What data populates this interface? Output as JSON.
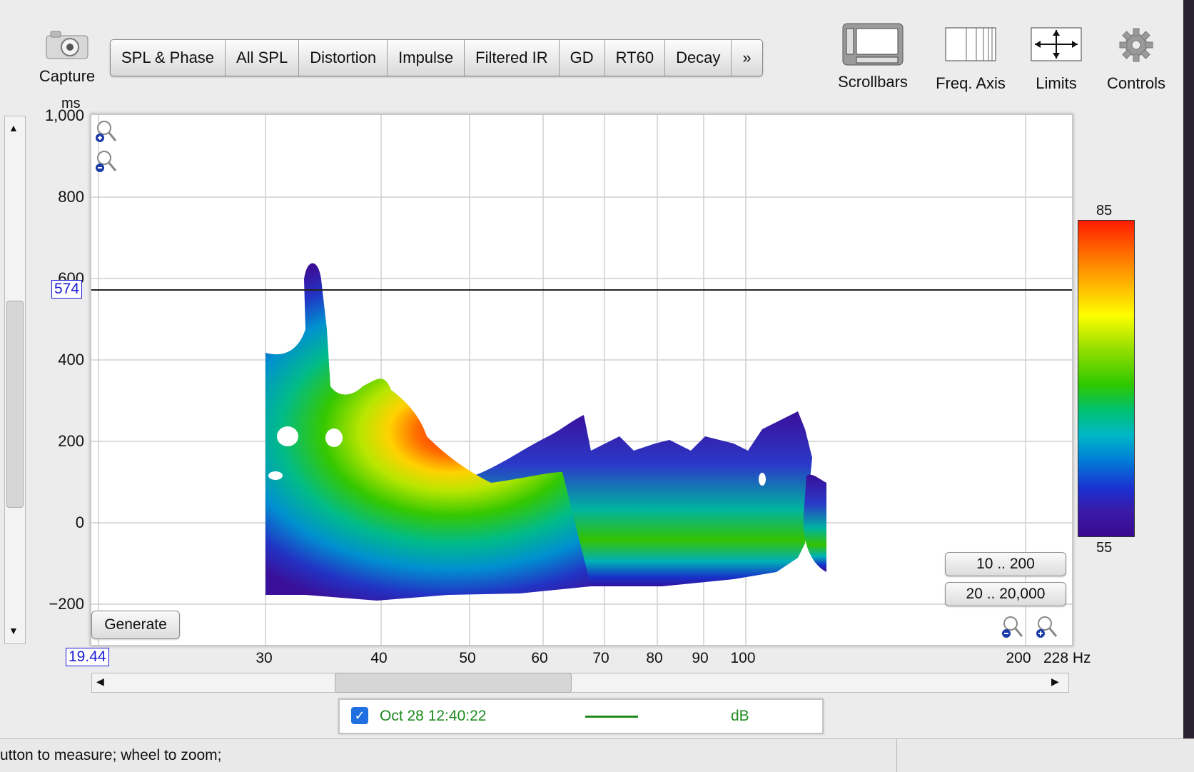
{
  "toolbar": {
    "capture_label": "Capture",
    "tabs": [
      "SPL & Phase",
      "All SPL",
      "Distortion",
      "Impulse",
      "Filtered IR",
      "GD",
      "RT60",
      "Decay",
      "»"
    ],
    "right_tools": [
      "Scrollbars",
      "Freq. Axis",
      "Limits",
      "Controls"
    ]
  },
  "plot": {
    "y_unit": "ms",
    "y_ticks": [
      "1,000",
      "800",
      "600",
      "400",
      "200",
      "0",
      "−200"
    ],
    "y_cursor": "574",
    "x_start": "19.44",
    "x_ticks": [
      "30",
      "40",
      "50",
      "60",
      "70",
      "80",
      "90",
      "100",
      "200"
    ],
    "x_end": "228 Hz",
    "colorbar_max": "85",
    "colorbar_min": "55",
    "generate_label": "Generate",
    "range_buttons": [
      "10 .. 200",
      "20 .. 20,000"
    ]
  },
  "legend": {
    "checked": true,
    "name": "Oct 28 12:40:22",
    "unit": "dB",
    "color": "#1e8a1e"
  },
  "status": {
    "text": "utton to measure; wheel to zoom;"
  },
  "colors": {
    "accent": "#1f6fe0",
    "cursor_box": "#1a1ad8"
  }
}
